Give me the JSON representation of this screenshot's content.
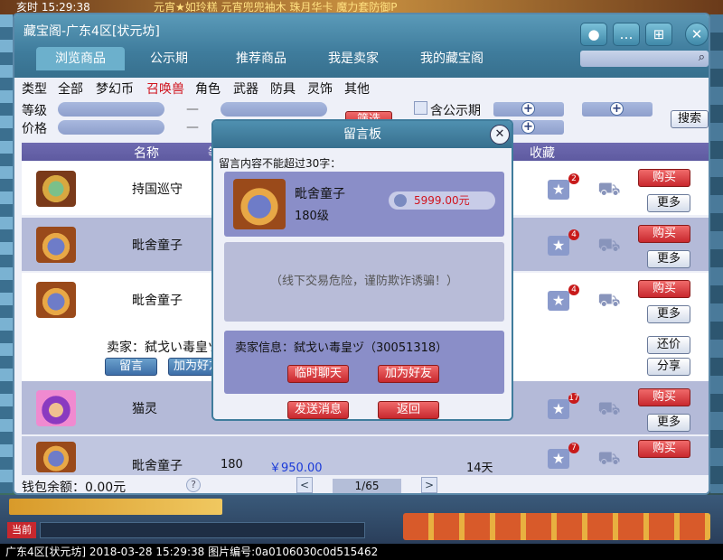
{
  "status_bar": {
    "clock": "亥时 15:29:38",
    "ticker": "元宵★如玲糕 元宵兜兜袖木 珠月华卡 魔力套防御P"
  },
  "window": {
    "title": "藏宝阁-广东4区[状元坊]"
  },
  "tabs": [
    "浏览商品",
    "公示期",
    "推荐商品",
    "我是卖家",
    "我的藏宝阁"
  ],
  "categories": {
    "label": "类型",
    "items": [
      "全部",
      "梦幻币",
      "召唤兽",
      "角色",
      "武器",
      "防具",
      "灵饰",
      "其他"
    ],
    "active_index": 2
  },
  "filters": {
    "level_label": "等级",
    "price_label": "价格",
    "dash": "—",
    "filter_button": "筛选",
    "public_label": "含公示期",
    "search_button": "搜索"
  },
  "table": {
    "columns": [
      "名称",
      "等",
      "收藏"
    ]
  },
  "rows": [
    {
      "name": "持国巡守",
      "fav_count": "2",
      "buy": "购买",
      "more": "更多"
    },
    {
      "name": "毗舍童子",
      "fav_count": "4",
      "buy": "购买",
      "more": "更多"
    },
    {
      "name": "毗舍童子",
      "fav_count": "4",
      "buy": "购买",
      "more": "更多"
    },
    {
      "name": "猫灵",
      "fav_count": "17",
      "buy": "购买",
      "more": "更多"
    },
    {
      "name": "毗舍童子",
      "level": "180",
      "price": "￥950.00",
      "period": "14天",
      "fav_count": "7",
      "buy": "购买",
      "more": "更多"
    }
  ],
  "expanded_seller": {
    "seller_text": "卖家：弑戈い毒皇ヅ",
    "message_button": "留言",
    "add_friend_button": "加为好友",
    "counter_offer": "还价",
    "share": "分享"
  },
  "footer": {
    "balance": "钱包余额：0.00元",
    "help": "?",
    "page": "1/65",
    "prev": "<",
    "next": ">"
  },
  "modal": {
    "title": "留言板",
    "note": "留言内容不能超过30字：",
    "item_name": "毗舍童子",
    "item_level": "180级",
    "item_price": "5999.00元",
    "warning": "（线下交易危险，谨防欺诈诱骗！）",
    "seller_info": "卖家信息：弑戈い毒皇ヅ（30051318）",
    "temp_chat": "临时聊天",
    "add_friend": "加为好友",
    "send": "发送消息",
    "back": "返回"
  },
  "caption": "广东4区[状元坊] 2018-03-28 15:29:38 图片编号:0a0106030c0d515462",
  "hud": {
    "current_label": "当前"
  }
}
